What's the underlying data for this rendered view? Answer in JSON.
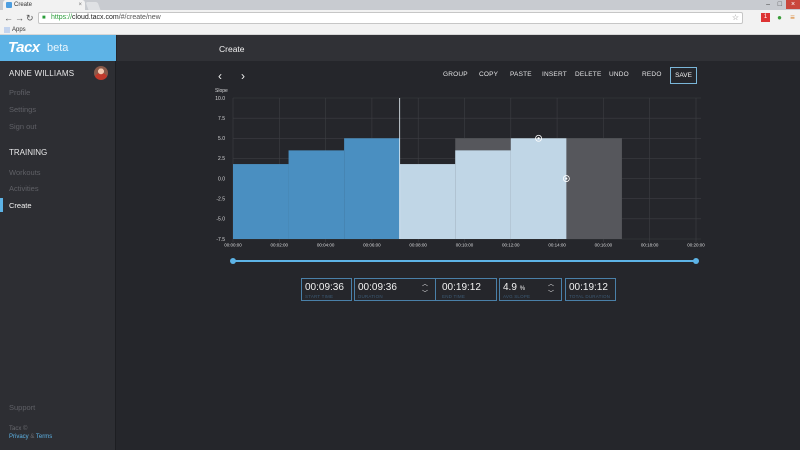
{
  "browser": {
    "tab_title": "Create",
    "tab_close": "×",
    "url_https": "https://",
    "url_host": "cloud.tacx.com",
    "url_path": "/#/create/new",
    "bookmark_apps": "Apps"
  },
  "sidebar": {
    "brand_logo": "Tacx",
    "brand_beta": "beta",
    "user_name": "ANNE WILLIAMS",
    "account_items": [
      "Profile",
      "Settings",
      "Sign out"
    ],
    "training_header": "TRAINING",
    "training_items": [
      "Workouts",
      "Activities",
      "Create"
    ],
    "support": "Support",
    "footer_brand": "Tacx ©",
    "privacy": "Privacy",
    "amp": "&",
    "terms": "Terms"
  },
  "header": {
    "title": "Create"
  },
  "toolbar": {
    "group": "GROUP",
    "copy": "COPY",
    "paste": "PASTE",
    "insert": "INSERT",
    "delete": "DELETE",
    "undo": "UNDO",
    "redo": "REDO",
    "save": "SAVE"
  },
  "fields": {
    "start_time": {
      "value": "00:09:36",
      "label": "START TIME"
    },
    "duration": {
      "value": "00:09:36",
      "label": "DURATION"
    },
    "end_time": {
      "value": "00:19:12",
      "label": "END TIME"
    },
    "avg_slope": {
      "value": "4.9",
      "unit": "%",
      "label": "AVG SLOPE"
    },
    "total_duration": {
      "value": "00:19:12",
      "label": "TOTAL DURATION"
    }
  },
  "chart_data": {
    "type": "area",
    "ylabel": "Slope",
    "ylim": [
      -7.5,
      10
    ],
    "yticks": [
      "10.0",
      "7.5",
      "5.0",
      "2.5",
      "0.0",
      "-2.5",
      "-5.0",
      "-7.5"
    ],
    "xlim": [
      0,
      1200
    ],
    "xtick_labels": [
      "00:00:00",
      "00:02:00",
      "00:04:00",
      "00:06:00",
      "00:08:00",
      "00:10:00",
      "00:12:00",
      "00:14:00",
      "00:16:00",
      "00:18:00",
      "00:20:00"
    ],
    "grid": true,
    "segments": [
      {
        "start": 0,
        "end": 144,
        "value": 1.8,
        "state": "normal"
      },
      {
        "start": 144,
        "end": 288,
        "value": 3.5,
        "state": "normal"
      },
      {
        "start": 288,
        "end": 432,
        "value": 5.0,
        "state": "normal"
      },
      {
        "start": 432,
        "end": 576,
        "value": 1.8,
        "state": "selected"
      },
      {
        "start": 576,
        "end": 720,
        "value": 3.5,
        "state": "selected"
      },
      {
        "start": 720,
        "end": 864,
        "value": 5.0,
        "state": "selected"
      }
    ],
    "overlay_preview": {
      "start": 576,
      "end": 1008,
      "value": 5.0
    },
    "colors": {
      "normal": "#4a8fc1",
      "selected": "#c0d6e6",
      "overlay": "#56575c",
      "grid": "#3d3e43"
    }
  },
  "slider": {
    "range_start": 0,
    "range_end": 1
  }
}
